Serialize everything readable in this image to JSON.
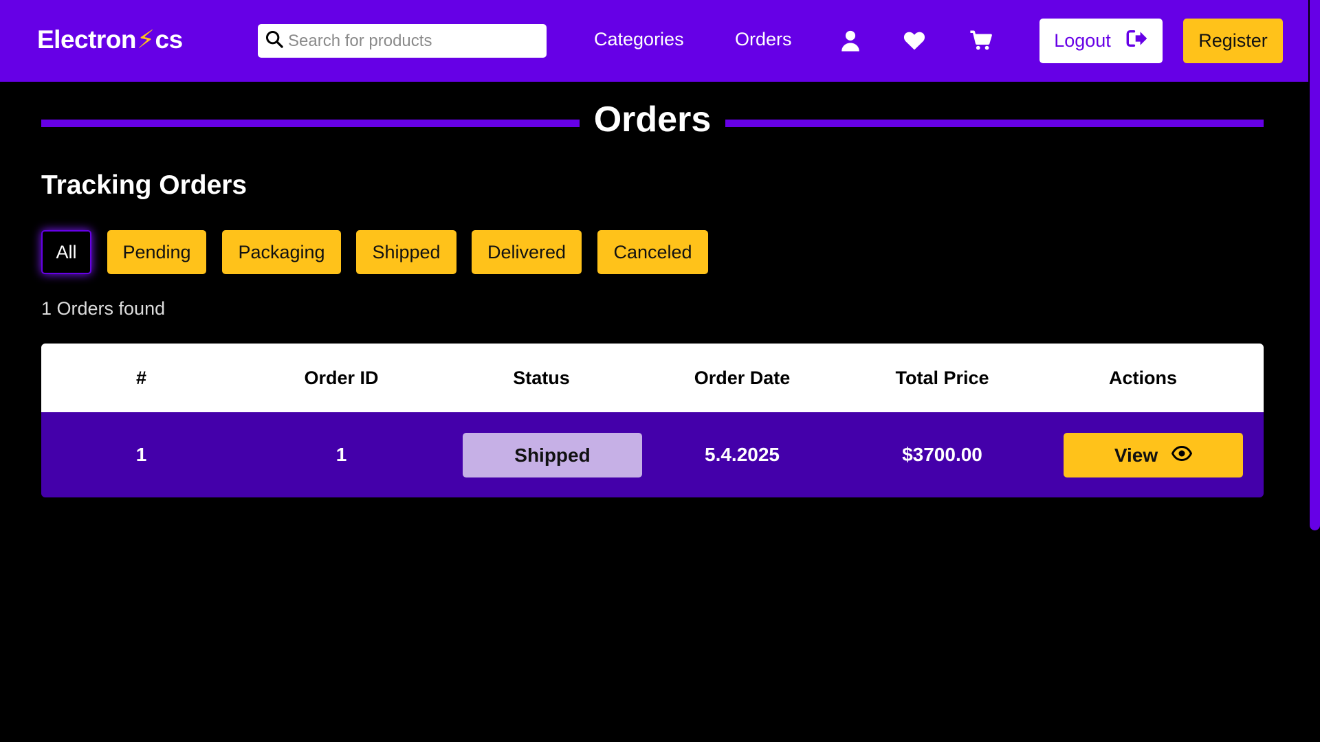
{
  "header": {
    "logo_prefix": "Electron",
    "logo_bolt": "⚡",
    "logo_suffix": "cs",
    "search_placeholder": "Search for products",
    "nav": {
      "categories": "Categories",
      "orders": "Orders"
    },
    "icons": [
      "user-icon",
      "heart-icon",
      "cart-icon"
    ],
    "logout_label": "Logout",
    "register_label": "Register"
  },
  "main": {
    "page_title": "Orders",
    "subtitle": "Tracking Orders",
    "filters": [
      "All",
      "Pending",
      "Packaging",
      "Shipped",
      "Delivered",
      "Canceled"
    ],
    "active_filter": "All",
    "found_text": "1 Orders found",
    "table": {
      "headers": [
        "#",
        "Order ID",
        "Status",
        "Order Date",
        "Total Price",
        "Actions"
      ],
      "rows": [
        {
          "index": "1",
          "order_id": "1",
          "status": "Shipped",
          "order_date": "5.4.2025",
          "total_price": "$3700.00",
          "action_label": "View"
        }
      ]
    }
  },
  "colors": {
    "brand": "#6600e6",
    "accent": "#ffc21a",
    "row_bg": "#4400aa",
    "status_shipped_bg": "#c6b0e6"
  }
}
